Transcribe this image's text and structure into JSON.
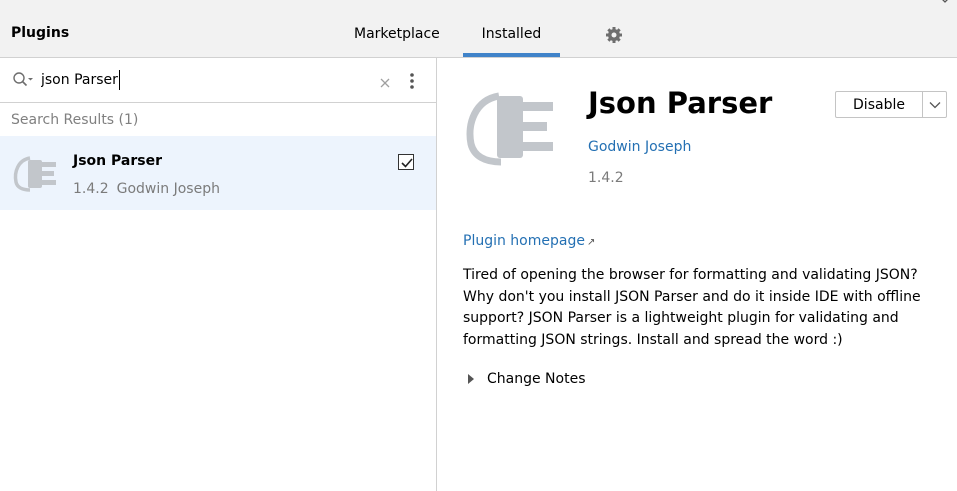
{
  "header": {
    "title": "Plugins",
    "tabs": [
      {
        "label": "Marketplace",
        "active": false
      },
      {
        "label": "Installed",
        "active": true
      }
    ],
    "settings_icon": "gear-icon",
    "accent_color": "#4083c9"
  },
  "search": {
    "value": "json Parser",
    "results_label": "Search Results (1)"
  },
  "results": [
    {
      "name": "Json Parser",
      "version": "1.4.2",
      "vendor": "Godwin Joseph",
      "checked": true,
      "icon": "plugin-plug-icon"
    }
  ],
  "detail": {
    "title": "Json Parser",
    "vendor": "Godwin Joseph",
    "version": "1.4.2",
    "disable_label": "Disable",
    "homepage_label": "Plugin homepage",
    "homepage_arrow": "↗",
    "description": "Tired of opening the browser for formatting and validating JSON? Why don't you install JSON Parser and do it inside IDE with offline support? JSON Parser is a lightweight plugin for validating and formatting JSON strings. Install and spread the word :)",
    "change_notes_label": "Change Notes",
    "link_color": "#2470b3"
  }
}
